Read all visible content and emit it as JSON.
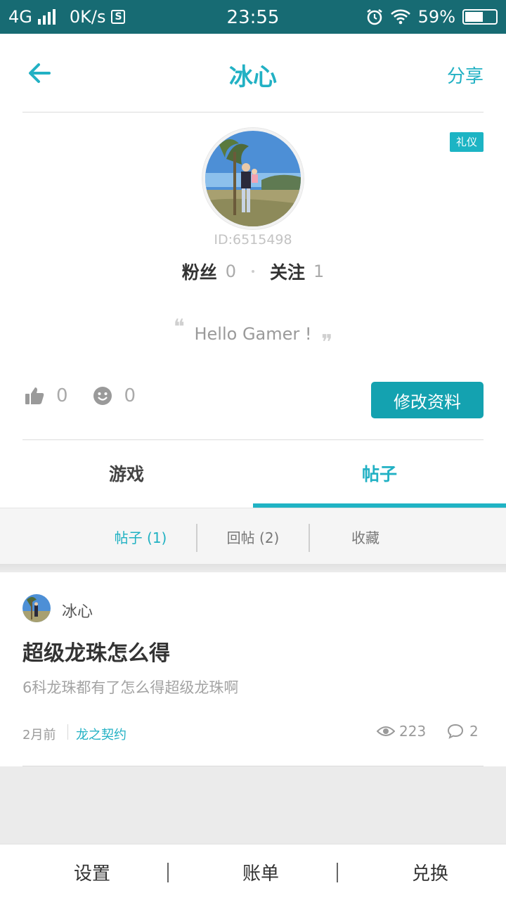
{
  "status_bar": {
    "network": "4G",
    "speed": "0K/s",
    "sync_icon": "S",
    "time": "23:55",
    "battery": "59%",
    "battery_level": 0.59
  },
  "header": {
    "title": "冰心",
    "share_label": "分享",
    "back_icon": "arrow-left-icon"
  },
  "profile": {
    "tag": "礼仪",
    "user_id": "ID:6515498",
    "fans_label": "粉丝",
    "fans_count": "0",
    "following_label": "关注",
    "following_count": "1",
    "motto": "Hello Gamer !",
    "likes_count": "0",
    "smiles_count": "0",
    "edit_button": "修改资料"
  },
  "tabs": [
    {
      "label": "游戏",
      "active": false
    },
    {
      "label": "帖子",
      "active": true
    }
  ],
  "subtabs": [
    {
      "label": "帖子 (1)",
      "active": true
    },
    {
      "label": "回帖 (2)",
      "active": false
    },
    {
      "label": "收藏",
      "active": false
    }
  ],
  "post": {
    "author": "冰心",
    "title": "超级龙珠怎么得",
    "excerpt": "6科龙珠都有了怎么得超级龙珠啊",
    "time": "2月前",
    "game": "龙之契约",
    "views": "223",
    "comments": "2"
  },
  "bottom_bar": [
    {
      "label": "设置"
    },
    {
      "label": "账单"
    },
    {
      "label": "兑换"
    }
  ],
  "colors": {
    "accent": "#22b1c4",
    "status_bar": "#176b73",
    "button": "#14a2b0"
  }
}
